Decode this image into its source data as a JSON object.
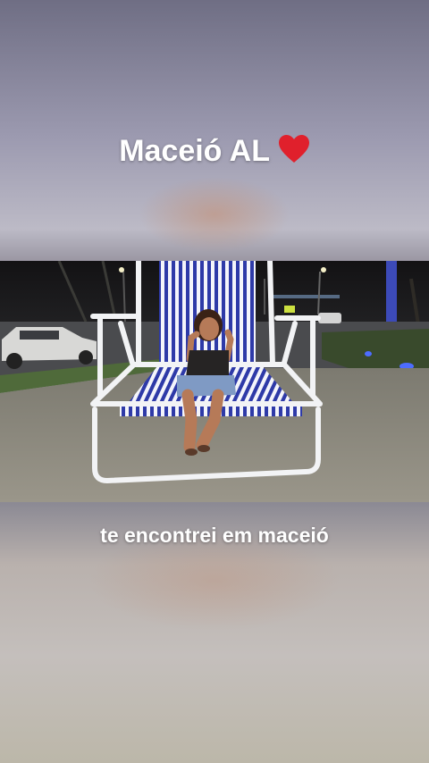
{
  "top_caption": "Maceió AL",
  "top_caption_emoji": "heart-icon",
  "bottom_caption": "te encontrei em maceió",
  "colors": {
    "caption_text": "#ffffff",
    "heart": "#e0202c",
    "chair_stripe_blue": "#2e3aa8",
    "chair_frame": "#f2f3f5",
    "night_sky": "#171618"
  }
}
